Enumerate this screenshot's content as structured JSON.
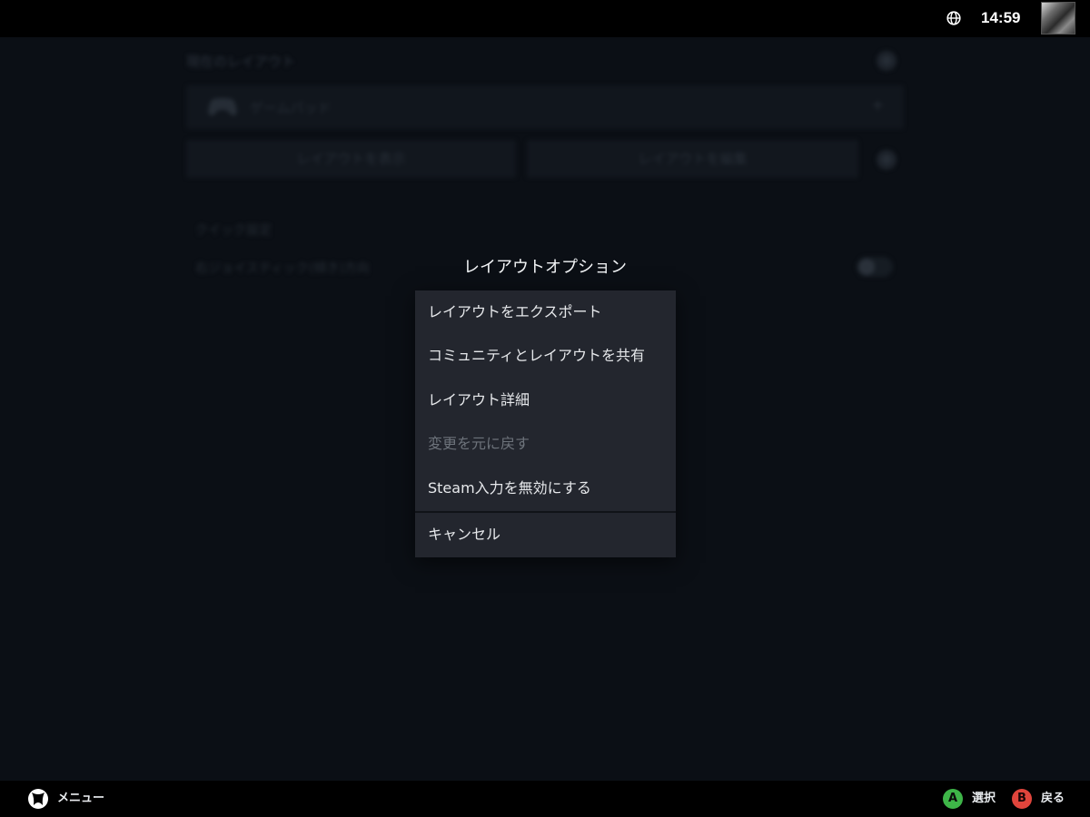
{
  "topbar": {
    "clock": "14:59",
    "globe_icon": "globe-icon",
    "avatar_icon": "user-avatar"
  },
  "background": {
    "heading": "現在のレイアウト",
    "layout_select_label": "ゲームパッド",
    "view_layout_label": "レイアウトを表示",
    "edit_layout_label": "レイアウトを編集",
    "section_heading": "クイック設定",
    "setting_row_label": "右ジョイスティック(傾き)方向"
  },
  "dialog": {
    "title": "レイアウトオプション",
    "items": [
      {
        "label": "レイアウトをエクスポート",
        "enabled": true
      },
      {
        "label": "コミュニティとレイアウトを共有",
        "enabled": true
      },
      {
        "label": "レイアウト詳細",
        "enabled": true
      },
      {
        "label": "変更を元に戻す",
        "enabled": false
      },
      {
        "label": "Steam入力を無効にする",
        "enabled": true
      }
    ],
    "cancel_label": "キャンセル"
  },
  "bottombar": {
    "menu_label": "メニュー",
    "select_button": "A",
    "select_label": "選択",
    "back_button": "B",
    "back_label": "戻る",
    "colors": {
      "a_button": "#3eb548",
      "b_button": "#e0453c"
    }
  }
}
